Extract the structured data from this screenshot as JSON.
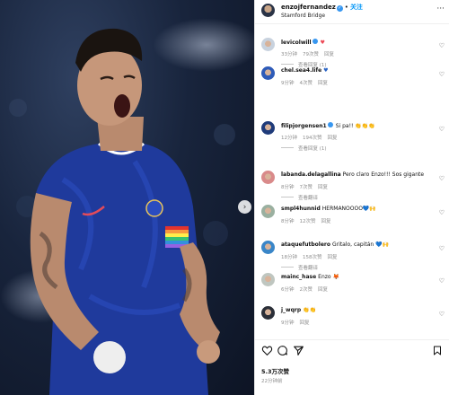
{
  "post": {
    "username": "enzojfernandez",
    "dot": "•",
    "follow_label": "关注",
    "location": "Stamford Bridge",
    "more_label": "···"
  },
  "comments": [
    {
      "user": "levicolwill",
      "text": "♥",
      "text_color": "#ed4956",
      "verified": true,
      "time": "33分钟",
      "likes": "79次赞",
      "reply_label": "回复",
      "replies": "查看回复 (1)",
      "avatar_color": "#c8d2de"
    },
    {
      "user": "chel.sea4.life",
      "text": "♥",
      "text_color": "#2a64c5",
      "verified": false,
      "time": "9分钟",
      "likes": "4次赞",
      "reply_label": "回复",
      "replies": "",
      "avatar_color": "#2e5bb8"
    },
    {
      "user": "filipjorgensen1",
      "text": "Si pa!! 👏👏👏",
      "text_color": "#111111",
      "verified": true,
      "time": "12分钟",
      "likes": "194次赞",
      "reply_label": "回复",
      "replies": "查看回复 (1)",
      "avatar_color": "#1f3b7a"
    },
    {
      "user": "labanda.delagallina",
      "text": "Pero claro Enzo!!! Sos gigante",
      "text_color": "#111111",
      "verified": false,
      "time": "8分钟",
      "likes": "7次赞",
      "reply_label": "回复",
      "replies": "查看翻译",
      "avatar_color": "#d98a8a"
    },
    {
      "user": "smpl4hunnid",
      "text": "HERMANOOOO💙🙌",
      "text_color": "#111111",
      "verified": false,
      "time": "8分钟",
      "likes": "12次赞",
      "reply_label": "回复",
      "replies": "",
      "avatar_color": "#9ab0a0"
    },
    {
      "user": "ataquefutbolero",
      "text": "Gritalo, capitán 💙🙌",
      "text_color": "#111111",
      "verified": false,
      "time": "18分钟",
      "likes": "158次赞",
      "reply_label": "回复",
      "replies": "查看翻译",
      "avatar_color": "#3a86c8"
    },
    {
      "user": "mainc_hase",
      "text": "Enzo 🦊",
      "text_color": "#111111",
      "verified": false,
      "time": "6分钟",
      "likes": "2次赞",
      "reply_label": "回复",
      "replies": "",
      "avatar_color": "#bfc6c0"
    },
    {
      "user": "j_wqrp",
      "text": "👏👏",
      "text_color": "#111111",
      "verified": false,
      "time": "9分钟",
      "likes": "",
      "reply_label": "回复",
      "replies": "",
      "avatar_color": "#2b2f38"
    }
  ],
  "actions": {
    "like_icon": "heart-icon",
    "comment_icon": "comment-icon",
    "share_icon": "share-icon",
    "save_icon": "bookmark-icon",
    "likes_count": "5.3万次赞",
    "time_ago": "22分钟前"
  },
  "photo": {
    "next_arrow": "›",
    "kit_color": "#1f3a9c"
  }
}
